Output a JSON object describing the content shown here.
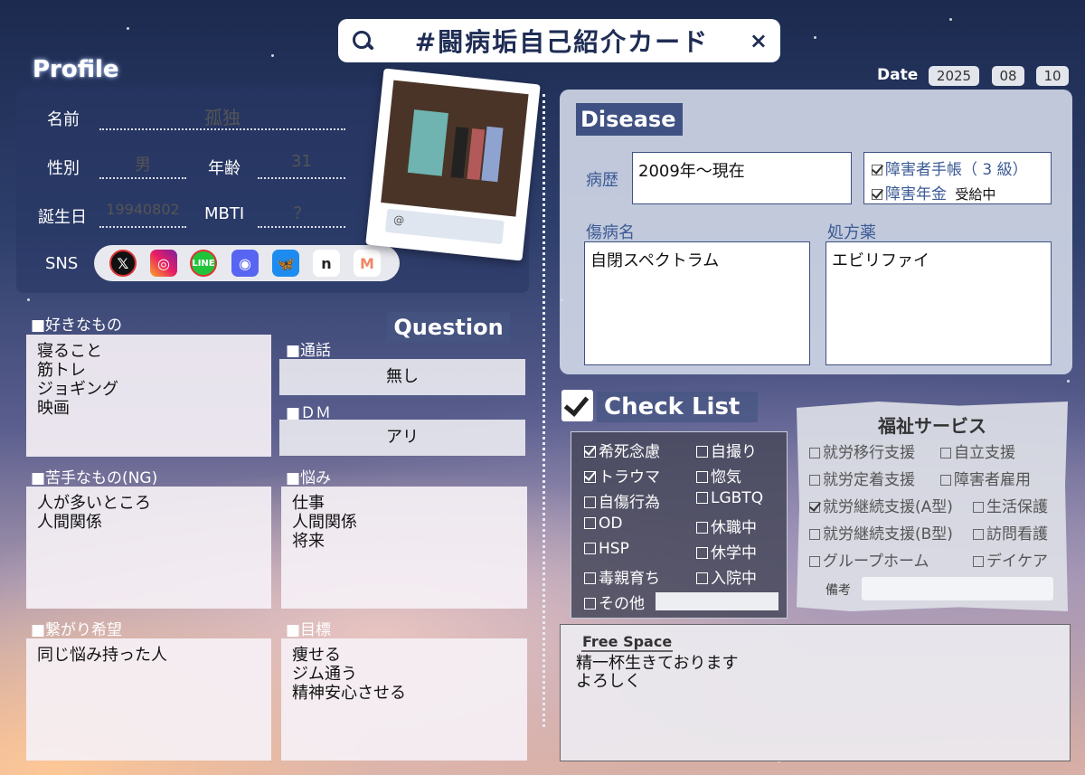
{
  "search": {
    "query": "#闘病垢自己紹介カード",
    "close": "×"
  },
  "date": {
    "label": "Date",
    "year": "2025",
    "month": "08",
    "day": "10"
  },
  "profile": {
    "title": "Profile",
    "name_label": "名前",
    "name": "孤独",
    "gender_label": "性別",
    "gender": "男",
    "age_label": "年齢",
    "age": "31",
    "birthday_label": "誕生日",
    "birthday": "19940802",
    "mbti_label": "MBTI",
    "mbti": "？",
    "sns_label": "SNS",
    "sns_icons": [
      "x-icon",
      "instagram-icon",
      "line-icon",
      "discord-icon",
      "bluesky-icon",
      "note-icon",
      "misskey-icon"
    ],
    "photo_handle": "@"
  },
  "likes": {
    "label": "■好きなもの",
    "text": "寝ること\n筋トレ\nジョギング\n映画"
  },
  "dislikes": {
    "label": "■苦手なもの(NG)",
    "text": "人が多いところ\n人間関係"
  },
  "connect": {
    "label": "■繋がり希望",
    "text": "同じ悩み持った人"
  },
  "question": {
    "title": "Question",
    "call_label": "■通話",
    "call": "無し",
    "dm_label": "■ＤＭ",
    "dm": "アリ",
    "worry_label": "■悩み",
    "worry": "仕事\n人間関係\n将来",
    "goal_label": "■目標",
    "goal": "痩せる\nジム通う\n精神安心させる"
  },
  "disease": {
    "title": "Disease",
    "history_label": "病歴",
    "history": "2009年～現在",
    "handbook": "障害者手帳（ 3 級）",
    "handbook_checked": true,
    "pension": "障害年金",
    "pension_status": "受給中",
    "pension_checked": true,
    "diagnosis_label": "傷病名",
    "diagnosis": "自閉スペクトラム",
    "medicine_label": "処方薬",
    "medicine": "エビリファイ"
  },
  "checklist": {
    "title": "Check List",
    "items": [
      {
        "label": "希死念慮",
        "checked": true
      },
      {
        "label": "自撮り",
        "checked": false
      },
      {
        "label": "トラウマ",
        "checked": true
      },
      {
        "label": "惚気",
        "checked": false
      },
      {
        "label": "自傷行為",
        "checked": false
      },
      {
        "label": "LGBTQ",
        "checked": false
      },
      {
        "label": "OD",
        "checked": false
      },
      {
        "label": "休職中",
        "checked": false
      },
      {
        "label": "HSP",
        "checked": false
      },
      {
        "label": "休学中",
        "checked": false
      },
      {
        "label": "毒親育ち",
        "checked": false
      },
      {
        "label": "入院中",
        "checked": false
      },
      {
        "label": "その他",
        "checked": false
      }
    ]
  },
  "welfare": {
    "title": "福祉サービス",
    "items": [
      {
        "label": "就労移行支援",
        "checked": false
      },
      {
        "label": "自立支援",
        "checked": false
      },
      {
        "label": "就労定着支援",
        "checked": false
      },
      {
        "label": "障害者雇用",
        "checked": false
      },
      {
        "label": "就労継続支援(A型)",
        "checked": true
      },
      {
        "label": "生活保護",
        "checked": false
      },
      {
        "label": "就労継続支援(B型)",
        "checked": false
      },
      {
        "label": "訪問看護",
        "checked": false
      },
      {
        "label": "グループホーム",
        "checked": false
      },
      {
        "label": "デイケア",
        "checked": false
      }
    ],
    "notes_label": "備考"
  },
  "free_space": {
    "title": "Free Space",
    "text": "精一杯生きております\nよろしく"
  },
  "colors": {
    "navy": "#3f5182",
    "panel": "#d2d8e8"
  }
}
